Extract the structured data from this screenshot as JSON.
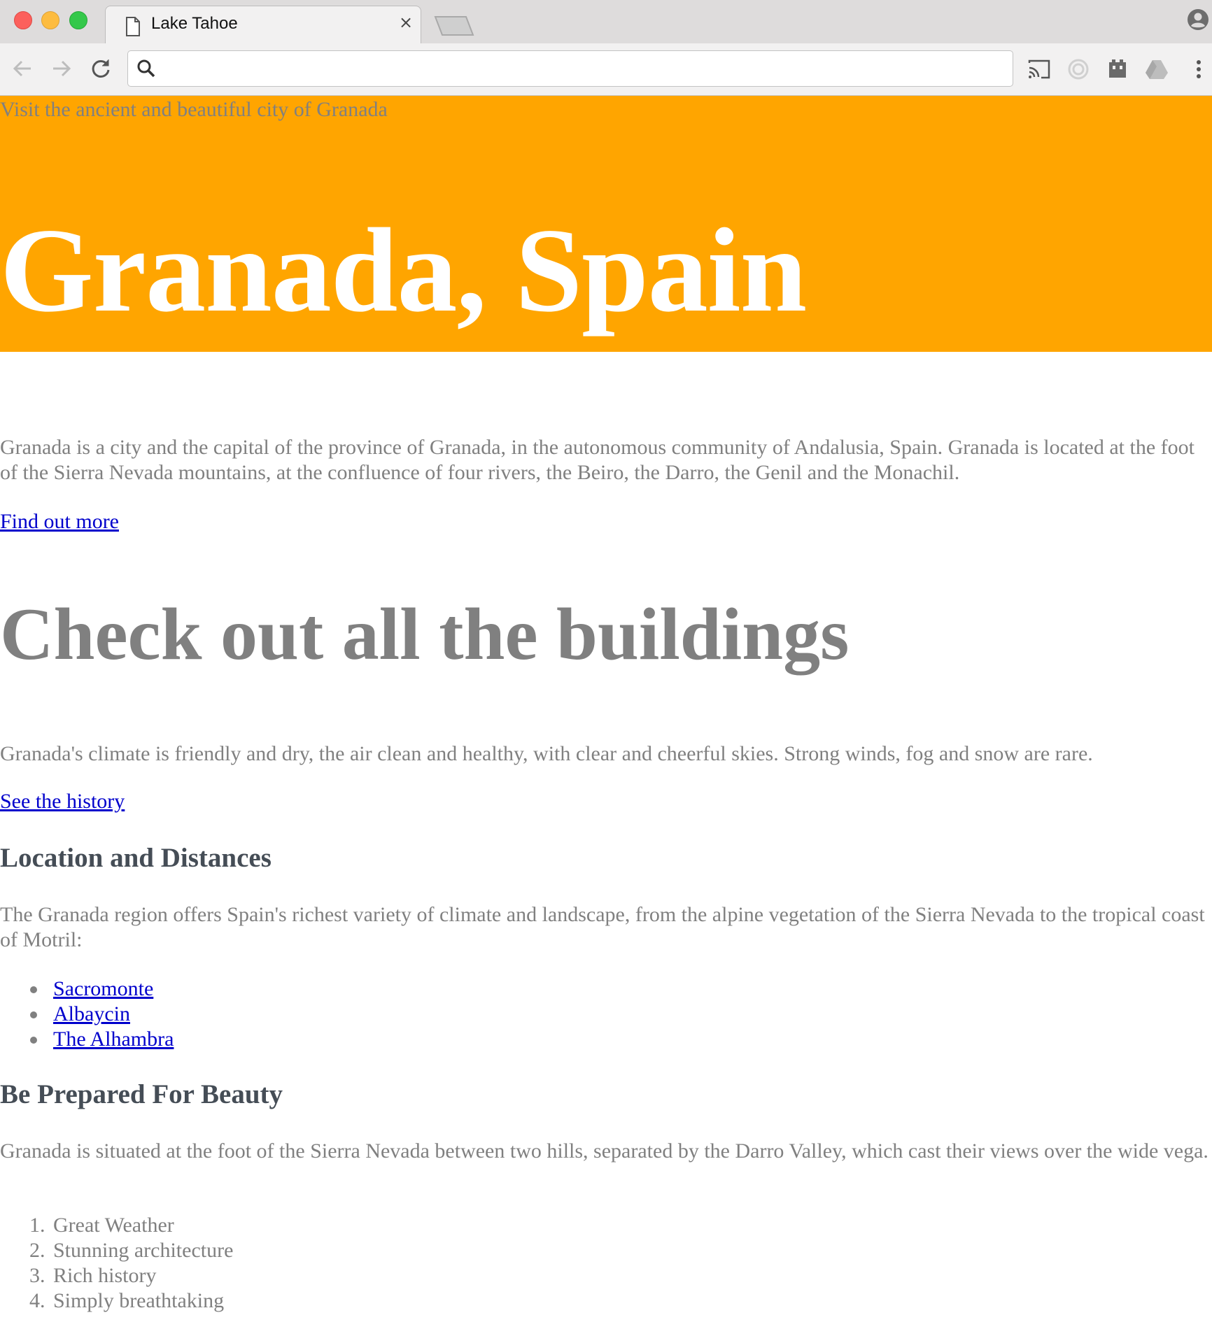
{
  "browser": {
    "tab_title": "Lake Tahoe",
    "tab_close": "×",
    "address_value": "",
    "icons": [
      "document-icon",
      "close-icon",
      "new-tab-icon",
      "profile-icon",
      "back-icon",
      "forward-icon",
      "reload-icon",
      "search-icon",
      "cast-icon",
      "extension-icon",
      "extension-icon",
      "drive-icon",
      "menu-icon"
    ]
  },
  "hero": {
    "tagline": "Visit the ancient and beautiful city of Granada",
    "title": "Granada, Spain",
    "background": "#ffa500"
  },
  "intro": {
    "text": "Granada is a city and the capital of the province of Granada, in the autonomous community of Andalusia, Spain. Granada is located at the foot of the Sierra Nevada mountains, at the confluence of four rivers, the Beiro, the Darro, the Genil and the Monachil.",
    "link": "Find out more"
  },
  "buildings": {
    "heading": "Check out all the buildings",
    "text": "Granada's climate is friendly and dry, the air clean and healthy, with clear and cheerful skies. Strong winds, fog and snow are rare.",
    "link": "See the history"
  },
  "location": {
    "heading": "Location and Distances",
    "text": "The Granada region offers Spain's richest variety of climate and landscape, from the alpine vegetation of the Sierra Nevada to the tropical coast of Motril:",
    "items": [
      "Sacromonte",
      "Albaycin",
      "The Alhambra"
    ]
  },
  "beauty": {
    "heading": "Be Prepared For Beauty",
    "text": "Granada is situated at the foot of the Sierra Nevada between two hills, separated by the Darro Valley, which cast their views over the wide vega.",
    "items": [
      {
        "num": "1.",
        "text": "Great Weather"
      },
      {
        "num": "2.",
        "text": "Stunning architecture"
      },
      {
        "num": "3.",
        "text": "Rich history"
      },
      {
        "num": "4.",
        "text": "Simply breathtaking"
      }
    ]
  },
  "colors": {
    "link": "#0000cc",
    "body_text": "#808080",
    "subheading": "#454d56"
  }
}
